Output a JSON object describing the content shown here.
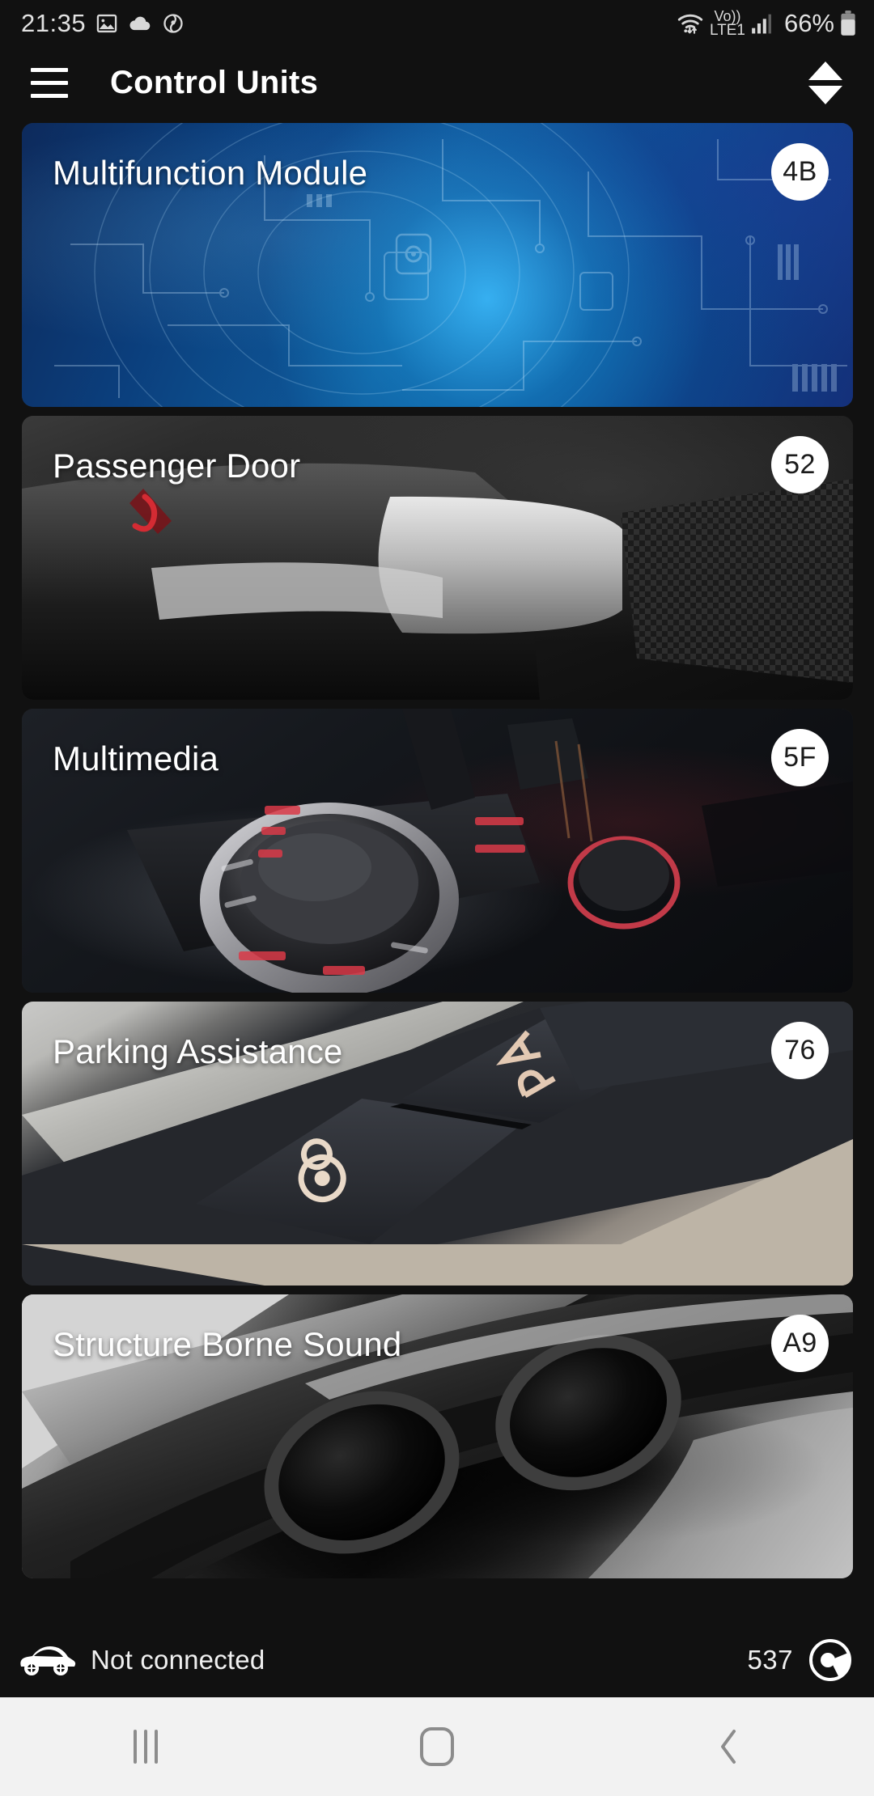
{
  "status_bar": {
    "time": "21:35",
    "left_icons": [
      "image-icon",
      "cloud-icon",
      "clock-alarm-icon"
    ],
    "network_label_top": "Vo))",
    "network_label_bottom": "LTE1",
    "battery_percent": "66%",
    "right_icons": [
      "wifi-icon",
      "volte-icon",
      "signal-bars-icon",
      "battery-icon"
    ]
  },
  "app_bar": {
    "menu_icon": "hamburger-menu-icon",
    "title": "Control Units",
    "sort_icon": "sort-up-down-icon"
  },
  "control_units": [
    {
      "title": "Multifunction Module",
      "badge": "4B",
      "image": "blue-circuit-board-image"
    },
    {
      "title": "Passenger Door",
      "badge": "52",
      "image": "car-door-handle-image"
    },
    {
      "title": "Multimedia",
      "badge": "5F",
      "image": "center-console-knob-image"
    },
    {
      "title": "Parking Assistance",
      "badge": "76",
      "image": "pdc-pla-buttons-image"
    },
    {
      "title": "Structure Borne Sound",
      "badge": "A9",
      "image": "exhaust-tailpipes-image"
    }
  ],
  "footer": {
    "car_icon": "car-icon",
    "connection_status": "Not connected",
    "counter": "537",
    "app_logo_icon": "carly-c-logo-icon"
  },
  "nav_bar": {
    "recents_label": "recents-icon",
    "home_label": "home-icon",
    "back_label": "back-icon"
  },
  "colors": {
    "background": "#111111",
    "app_bar_text": "#ffffff",
    "badge_background": "#ffffff",
    "badge_text": "#1b1b1b",
    "nav_bar_background": "#f2f2f2",
    "nav_icon": "#8c8c8c",
    "status_text": "#e2e2e2"
  }
}
